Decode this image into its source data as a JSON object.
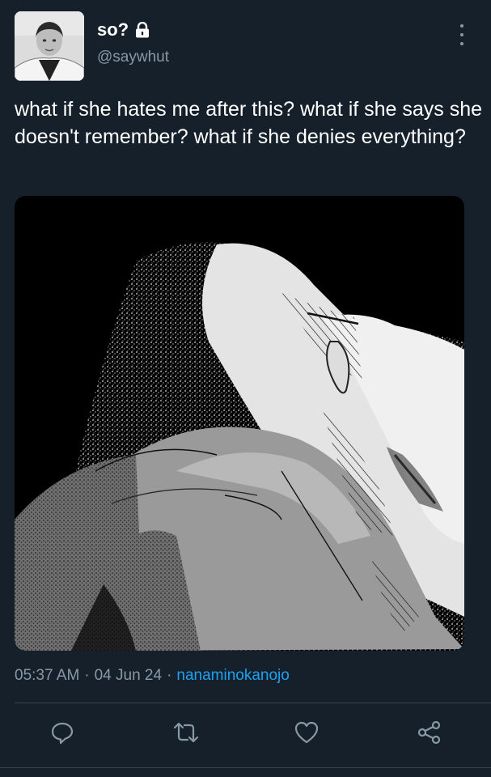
{
  "author": {
    "display_name": "so?",
    "handle": "@saywhut",
    "avatar": "avatar"
  },
  "tweet": {
    "text": "what if she hates me after this? what if she says she doesn't remember? what if she denies everything?",
    "time": "05:37 AM",
    "date": "04 Jun 24",
    "separator": "·",
    "source": "nanaminokanojo"
  },
  "actions": {
    "reply_icon": "reply-icon",
    "retweet_icon": "retweet-icon",
    "like_icon": "heart-icon",
    "share_icon": "share-icon"
  },
  "colors": {
    "background": "#15202b",
    "text": "#ffffff",
    "muted": "#8899a6",
    "accent": "#1da1f2",
    "divider": "#38444d"
  }
}
